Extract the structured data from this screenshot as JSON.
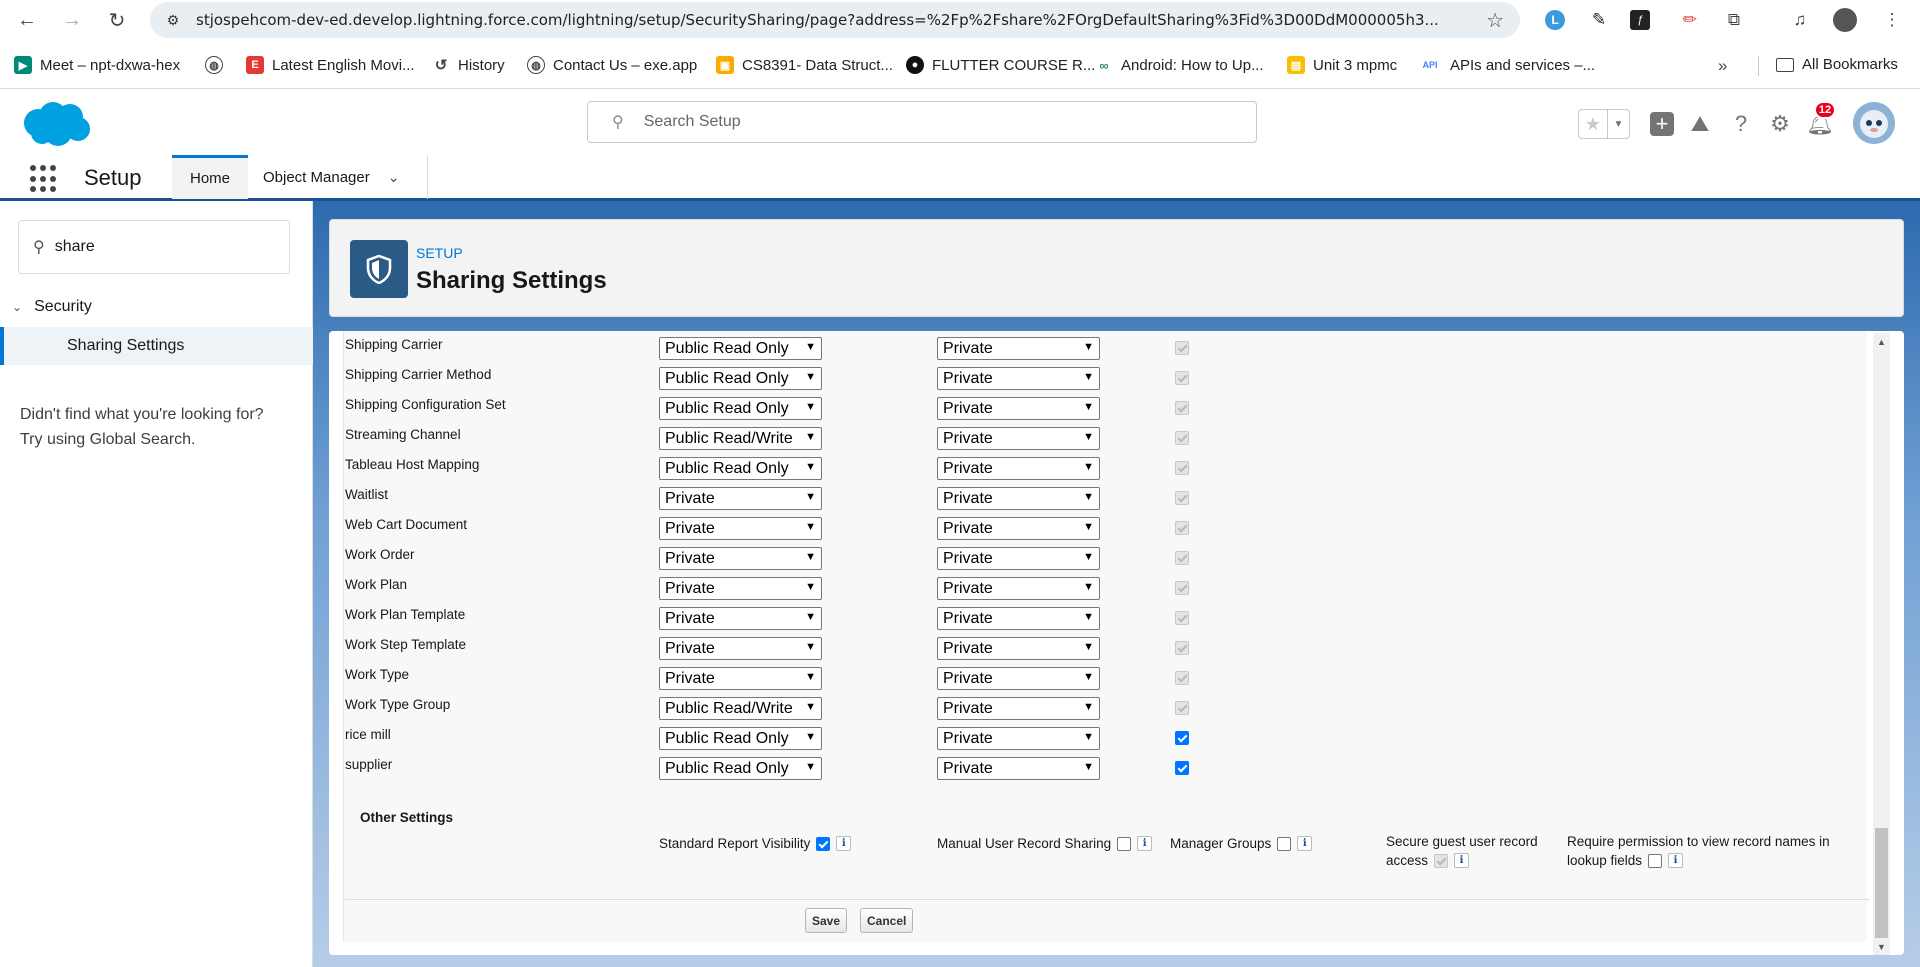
{
  "browser": {
    "url": "stjospehcom-dev-ed.develop.lightning.force.com/lightning/setup/SecuritySharing/page?address=%2Fp%2Fshare%2FOrgDefaultSharing%3Fid%3D00DdM000005h3...",
    "bookmarks": [
      {
        "label": "Meet – npt-dxwa-hex",
        "icon": "meet-icon",
        "color": "#00897b"
      },
      {
        "label": "",
        "icon": "globe-icon",
        "color": "#444444"
      },
      {
        "label": "Latest English Movi...",
        "icon": "e-letter-icon",
        "color": "#e53935"
      },
      {
        "label": "History",
        "icon": "history-icon",
        "color": "#444444"
      },
      {
        "label": "Contact Us – exe.app",
        "icon": "globe-icon",
        "color": "#444444"
      },
      {
        "label": "CS8391- Data Struct...",
        "icon": "classroom-icon",
        "color": "#f9ab00"
      },
      {
        "label": "FLUTTER COURSE R...",
        "icon": "github-icon",
        "color": "#111111"
      },
      {
        "label": "Android: How to Up...",
        "icon": "geeks-icon",
        "color": "#2f8d46"
      },
      {
        "label": "Unit 3 mpmc",
        "icon": "slides-icon",
        "color": "#fbbc04"
      },
      {
        "label": "APIs and services –...",
        "icon": "api-icon",
        "color": "#4285f4"
      }
    ],
    "all_bookmarks": "All Bookmarks",
    "extension_badge": "L"
  },
  "sf": {
    "search_placeholder": "Search Setup",
    "app_name": "Setup",
    "tab_home": "Home",
    "tab_object_manager": "Object Manager",
    "notifications": "12",
    "brand_color": "#00a1e0"
  },
  "sidebar": {
    "quickfind_value": "share",
    "tree_parent": "Security",
    "tree_child": "Sharing Settings",
    "not_found_line1": "Didn't find what you're looking for?",
    "not_found_line2": "Try using Global Search."
  },
  "page": {
    "crumb": "SETUP",
    "title": "Sharing Settings"
  },
  "rows": [
    {
      "name": "Shipping Carrier",
      "internal": "Public Read Only",
      "external": "Private",
      "hierarchy": "disabled"
    },
    {
      "name": "Shipping Carrier Method",
      "internal": "Public Read Only",
      "external": "Private",
      "hierarchy": "disabled"
    },
    {
      "name": "Shipping Configuration Set",
      "internal": "Public Read Only",
      "external": "Private",
      "hierarchy": "disabled"
    },
    {
      "name": "Streaming Channel",
      "internal": "Public Read/Write",
      "external": "Private",
      "hierarchy": "disabled"
    },
    {
      "name": "Tableau Host Mapping",
      "internal": "Public Read Only",
      "external": "Private",
      "hierarchy": "disabled"
    },
    {
      "name": "Waitlist",
      "internal": "Private",
      "external": "Private",
      "hierarchy": "disabled"
    },
    {
      "name": "Web Cart Document",
      "internal": "Private",
      "external": "Private",
      "hierarchy": "disabled"
    },
    {
      "name": "Work Order",
      "internal": "Private",
      "external": "Private",
      "hierarchy": "disabled"
    },
    {
      "name": "Work Plan",
      "internal": "Private",
      "external": "Private",
      "hierarchy": "disabled"
    },
    {
      "name": "Work Plan Template",
      "internal": "Private",
      "external": "Private",
      "hierarchy": "disabled"
    },
    {
      "name": "Work Step Template",
      "internal": "Private",
      "external": "Private",
      "hierarchy": "disabled"
    },
    {
      "name": "Work Type",
      "internal": "Private",
      "external": "Private",
      "hierarchy": "disabled"
    },
    {
      "name": "Work Type Group",
      "internal": "Public Read/Write",
      "external": "Private",
      "hierarchy": "disabled"
    },
    {
      "name": "rice mill",
      "internal": "Public Read Only",
      "external": "Private",
      "hierarchy": "checked"
    },
    {
      "name": "supplier",
      "internal": "Public Read Only",
      "external": "Private",
      "hierarchy": "checked"
    }
  ],
  "other_settings": {
    "title": "Other Settings",
    "standard_report_visibility": "Standard Report Visibility",
    "manual_user_record_sharing": "Manual User Record Sharing",
    "manager_groups": "Manager Groups",
    "secure_guest_line1": "Secure guest user record",
    "secure_guest_line2": "access",
    "require_permission_line1": "Require permission to view record names in",
    "require_permission_line2": "lookup fields",
    "info_glyph": "i"
  },
  "buttons": {
    "save": "Save",
    "cancel": "Cancel"
  }
}
